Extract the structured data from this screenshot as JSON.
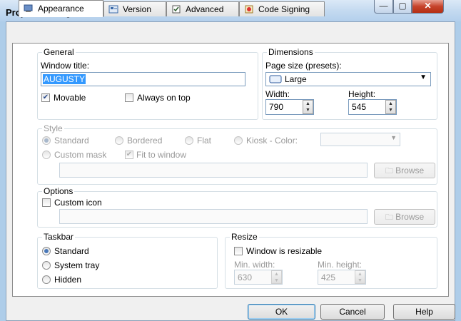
{
  "window": {
    "title": "Project Settings",
    "min_glyph": "—",
    "max_glyph": "▢",
    "close_glyph": "✕"
  },
  "tabs": [
    "Appearance",
    "Version",
    "Advanced",
    "Code Signing"
  ],
  "general": {
    "label": "General",
    "window_title_label": "Window title:",
    "window_title_value": "AUGUSTY",
    "movable_label": "Movable",
    "movable_checked": true,
    "always_on_top_label": "Always on top",
    "always_on_top_checked": false
  },
  "dimensions": {
    "label": "Dimensions",
    "page_size_label": "Page size (presets):",
    "page_size_value": "Large",
    "width_label": "Width:",
    "width_value": "790",
    "height_label": "Height:",
    "height_value": "545"
  },
  "style": {
    "label": "Style",
    "options": [
      "Standard",
      "Bordered",
      "Flat",
      "Kiosk - Color:"
    ],
    "selected": "Standard",
    "custom_mask_label": "Custom mask",
    "fit_to_window_label": "Fit to window",
    "fit_to_window_checked": true,
    "browse_label": "Browse"
  },
  "options_group": {
    "label": "Options",
    "custom_icon_label": "Custom icon",
    "custom_icon_checked": false,
    "browse_label": "Browse"
  },
  "taskbar": {
    "label": "Taskbar",
    "options": [
      "Standard",
      "System tray",
      "Hidden"
    ],
    "selected": "Standard"
  },
  "resize": {
    "label": "Resize",
    "resizable_label": "Window is resizable",
    "resizable_checked": false,
    "min_width_label": "Min. width:",
    "min_width_value": "630",
    "min_height_label": "Min. height:",
    "min_height_value": "425"
  },
  "footer": {
    "ok_label": "OK",
    "cancel_label": "Cancel",
    "help_label": "Help"
  },
  "colors": {
    "accent": "#3399ff",
    "selection_text": "#ffffff",
    "disabled_text": "#9a9a9a"
  }
}
